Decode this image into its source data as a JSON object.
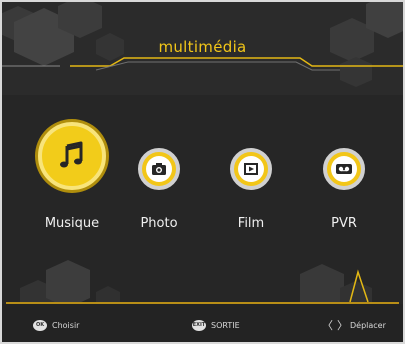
{
  "header": {
    "title": "multimédia"
  },
  "menu": {
    "items": [
      {
        "label": "Musique",
        "icon": "music-note-icon",
        "selected": true
      },
      {
        "label": "Photo",
        "icon": "camera-icon",
        "selected": false
      },
      {
        "label": "Film",
        "icon": "film-icon",
        "selected": false
      },
      {
        "label": "PVR",
        "icon": "record-icon",
        "selected": false
      }
    ]
  },
  "footer": {
    "ok_key": "OK",
    "ok_label": "Choisir",
    "exit_key": "EXIT",
    "exit_label": "SORTIE",
    "move_left": "〈",
    "move_right": "〉",
    "move_label": "Déplacer"
  },
  "colors": {
    "accent": "#f2c618",
    "background": "#262626",
    "text": "#f0f0f0"
  }
}
